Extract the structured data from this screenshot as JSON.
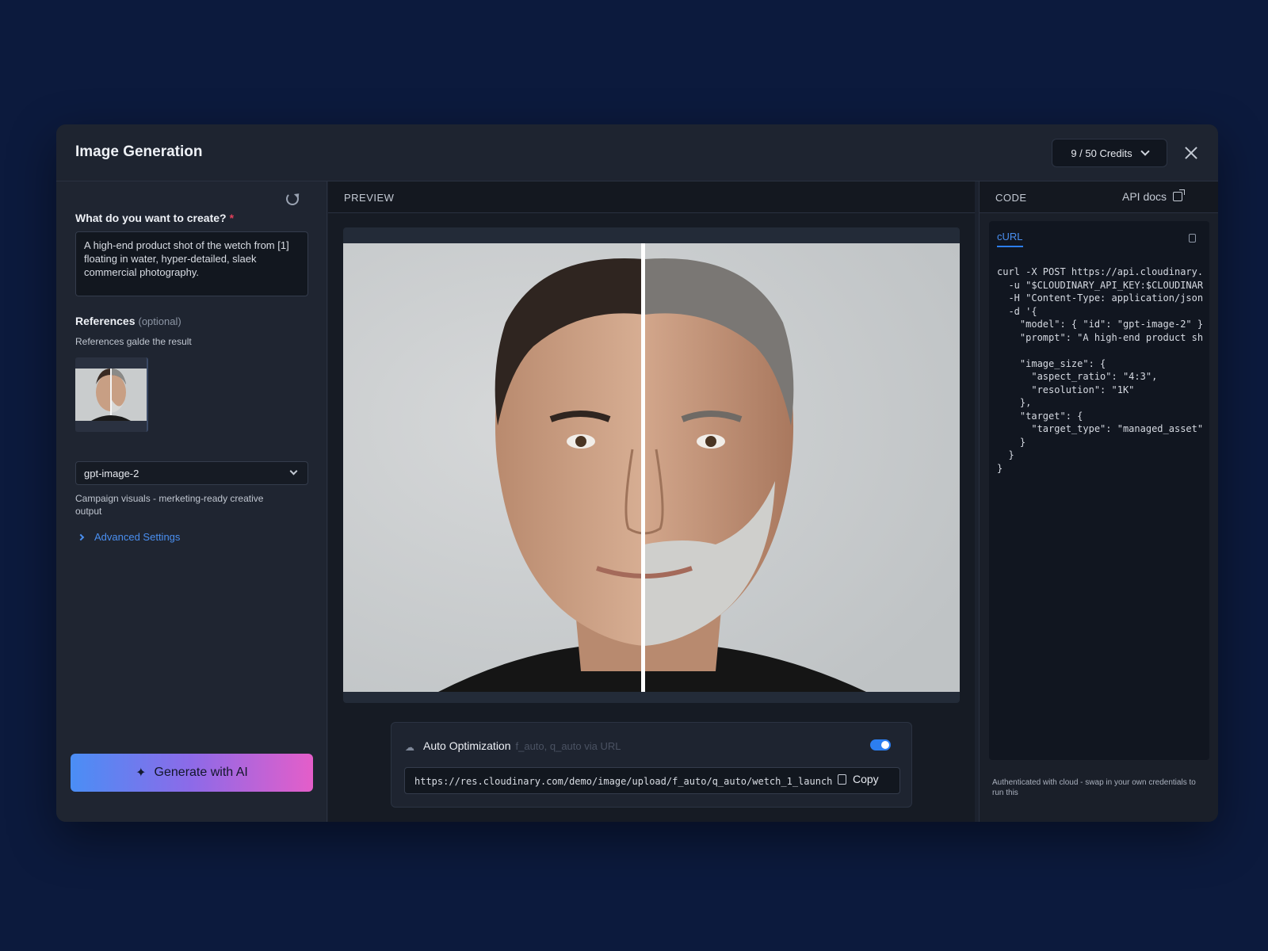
{
  "header": {
    "title": "Image Generation",
    "credits_label": "9 / 50  Credits"
  },
  "left_panel": {
    "prompt_label": "What do you want to create?",
    "required_mark": "*",
    "prompt_value": "A high-end product shot of the wetch from [1] floating in water, hyper-detailed, slaek commercial photography.",
    "references_label": "References",
    "references_optional": "(optional)",
    "references_sub": "References galde the result",
    "model_value": "gpt-image-2",
    "model_desc": "Campaign visuals - merketing-ready creative output",
    "advanced_label": "Advanced Settings",
    "generate_label": "Generate with AI"
  },
  "preview": {
    "label": "PREVIEW",
    "opt_title": "Auto Optimization",
    "opt_hint": "f_auto, q_auto via URL",
    "opt_enabled": true,
    "url_value": "https://res.cloudinary.com/demo/image/upload/f_auto/q_auto/wetch_1_launch",
    "copy_label": "Copy"
  },
  "code_panel": {
    "label": "CODE",
    "api_docs_label": "API docs",
    "tab_label": "cURL",
    "code": "curl -X POST https://api.cloudinary.\n  -u \"$CLOUDINARY_API_KEY:$CLOUDINAR\n  -H \"Content-Type: application/json\n  -d '{\n    \"model\": { \"id\": \"gpt-image-2\" }\n    \"prompt\": \"A high-end product sh\n\n    \"image_size\": {\n      \"aspect_ratio\": \"4:3\",\n      \"resolution\": \"1K\"\n    },\n    \"target\": {\n      \"target_type\": \"managed_asset\"\n    }\n  }\n}",
    "footer": "Authenticated with cloud - swap in your own credentials to run this"
  },
  "icons": {
    "refresh": "refresh-icon",
    "close": "close-icon",
    "sparkle": "sparkle-icon",
    "copy": "copy-icon",
    "external": "external-link-icon",
    "cloud": "cloud-icon"
  },
  "colors": {
    "background": "#0c1a3d",
    "accent": "#2c7ef0",
    "gradient_start": "#4a8ef5",
    "gradient_end": "#e45ec9"
  }
}
